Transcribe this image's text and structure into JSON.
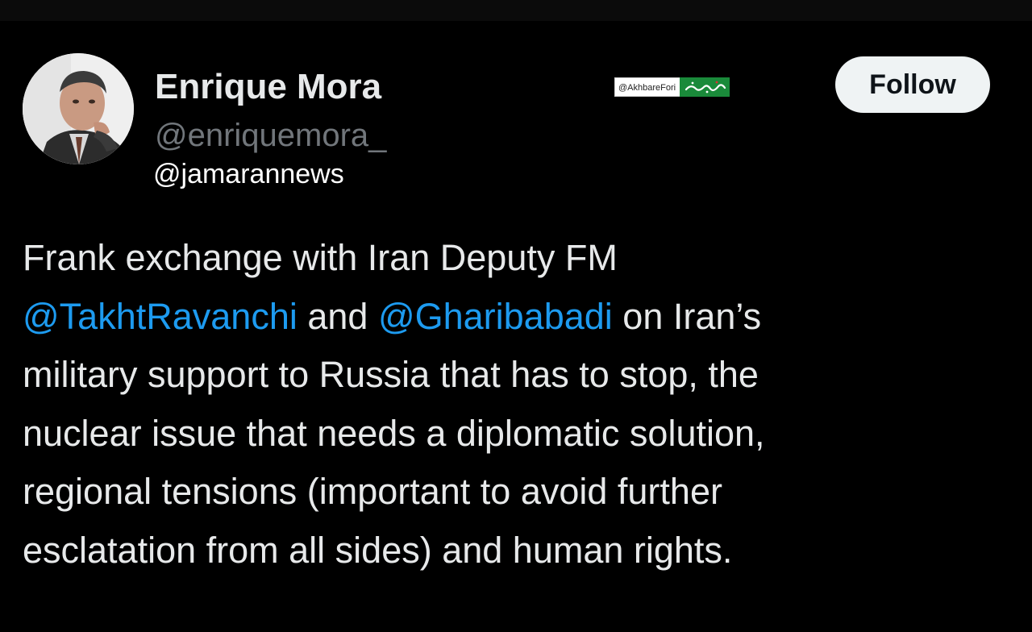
{
  "author": {
    "display_name": "Enrique Mora",
    "handle": "@enriquemora_",
    "avatar_icon": "profile-photo"
  },
  "overlay": {
    "source_handle": "@jamarannews"
  },
  "watermark": {
    "handle": "@AkhbareFori",
    "logo_color": "#1a8a3a"
  },
  "follow_label": "Follow",
  "tweet": {
    "line1": {
      "text": "Frank exchange with Iran Deputy FM"
    },
    "line2": {
      "mention1": "@TakhtRavanchi",
      "connector": " and ",
      "mention2": "@Gharibabadi",
      "tail": " on Iran’s"
    },
    "line3": {
      "text": "military support to Russia that has to stop, the"
    },
    "line4": {
      "text": "nuclear issue that needs a diplomatic solution,"
    },
    "line5": {
      "text": "regional tensions (important to avoid further"
    },
    "line6": {
      "text": "esclatation from all sides) and human rights."
    }
  },
  "colors": {
    "background": "#000000",
    "text": "#e7e9ea",
    "secondary_text": "#71767b",
    "mention": "#1d9bf0",
    "follow_button_bg": "#eff3f4"
  }
}
